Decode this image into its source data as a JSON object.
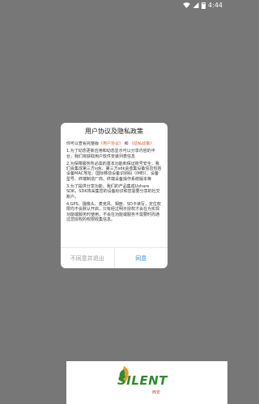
{
  "status_bar": {
    "time": "4:44"
  },
  "dialog": {
    "title": "用户协议及隐私政策",
    "intro_prefix": "你可以查看完整版",
    "user_agreement_link": "《用户协议》",
    "and": "和",
    "privacy_link": "《隐私政策》",
    "paragraphs": [
      "1.为了动态更新应用和动态显示可以分享内容的平台，我们将获取用户软件安装列表信息",
      "2.为保障服务所必需的基本功能和保证账号安全，我们会集成第三方sdk，第三方sdk会收集设备信息包括设备MAC地址、国际移动设备识别码（IMEI）、设备型号、终端制造厂商、终端设备操作系统版本等",
      "3.为了提供分享功能，我们的产品集成Ushare SDK，SDK将采集您的设备标识和您需要分享的社交账户。",
      "4.GPS、摄像头、麦克风、相册、SD卡读写，定位权限均不会默认开启，只有经过明示授权才会在为实现功能或服务时使用，不会在功能或服务不需要时而通过您授权的权限收集信息。"
    ],
    "decline_label": "不同意并退出",
    "agree_label": "同意"
  },
  "watermark": {
    "text": "SILENT",
    "sub": "西安"
  },
  "colors": {
    "overlay": "#777777",
    "link": "#e4562f",
    "agree": "#3a8fd6",
    "logo": "#2f8a2e"
  }
}
